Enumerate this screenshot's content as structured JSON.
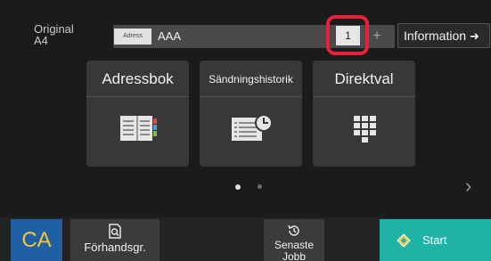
{
  "header": {
    "original_label": "Original",
    "paper_size": "A4",
    "address_badge": "Adress",
    "address_value": "AAA",
    "copy_count": "1",
    "plus_label": "+",
    "information_label": "Information"
  },
  "tiles": [
    {
      "label": "Adressbok",
      "icon": "address-book-icon"
    },
    {
      "label": "Sändningshistorik",
      "icon": "sending-history-icon"
    },
    {
      "label": "Direktval",
      "icon": "keypad-icon"
    }
  ],
  "pagination": {
    "pages": 2,
    "current": 1
  },
  "bottom": {
    "ca_label": "CA",
    "preview_label": "Förhandsgr.",
    "recent_label_line1": "Senaste",
    "recent_label_line2": "Jobb",
    "start_label": "Start"
  },
  "colors": {
    "highlight": "#e8203a",
    "ca_bg": "#1f5fa3",
    "ca_text": "#f2c73b",
    "start_bg": "#1fb3a8"
  }
}
